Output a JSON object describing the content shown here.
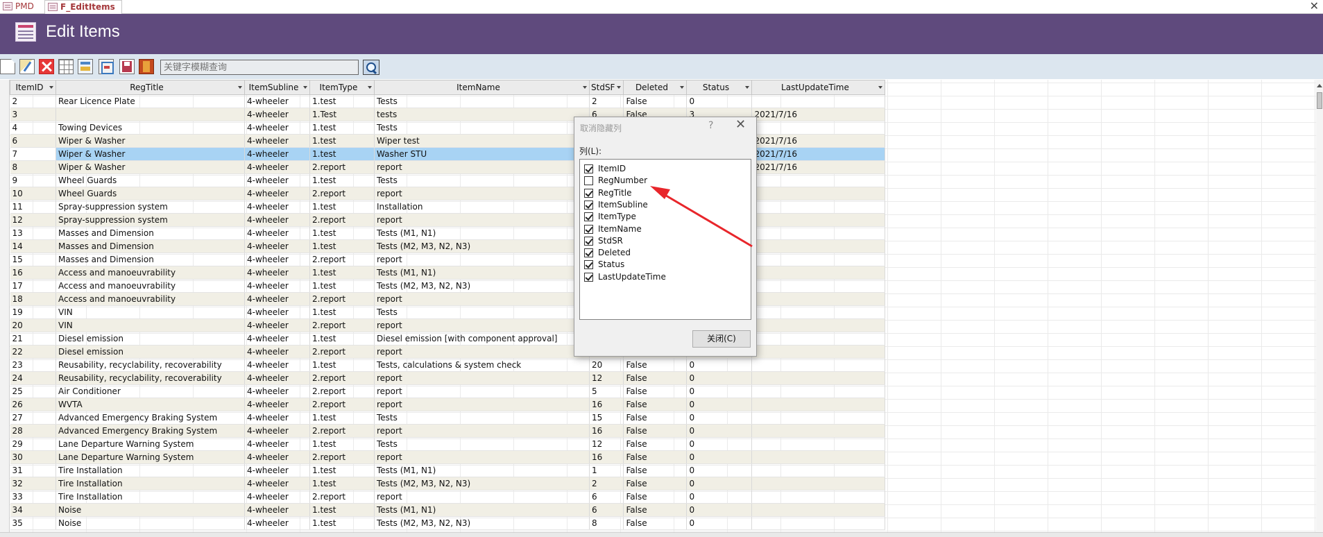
{
  "tabs": [
    {
      "label": "PMD"
    },
    {
      "label": "F_EditItems"
    }
  ],
  "window": {
    "close_glyph": "✕"
  },
  "header": {
    "title": "Edit Items"
  },
  "toolbar": {
    "buttons": [
      "new-record",
      "edit-record",
      "delete-record",
      "datasheet-view",
      "form-view",
      "form-view-alt",
      "save",
      "exit"
    ],
    "search_placeholder": "关键字模糊查询"
  },
  "table": {
    "columns": [
      {
        "label": "ItemID"
      },
      {
        "label": "RegTitle"
      },
      {
        "label": "ItemSubline"
      },
      {
        "label": "ItemType"
      },
      {
        "label": "ItemName"
      },
      {
        "label": "StdSF"
      },
      {
        "label": "Deleted"
      },
      {
        "label": "Status"
      },
      {
        "label": "LastUpdateTime"
      }
    ],
    "selected_row": 4,
    "rows": [
      [
        "2",
        "Rear Licence Plate",
        "4-wheeler",
        "1.test",
        "Tests",
        "2",
        "False",
        "0",
        ""
      ],
      [
        "3",
        "",
        "4-wheeler",
        "1.Test",
        "tests",
        "6",
        "False",
        "3",
        "2021/7/16"
      ],
      [
        "4",
        "Towing Devices",
        "4-wheeler",
        "1.test",
        "Tests",
        "",
        "",
        "",
        ""
      ],
      [
        "6",
        "Wiper & Washer",
        "4-wheeler",
        "1.test",
        "Wiper test",
        "",
        "",
        "",
        "2021/7/16"
      ],
      [
        "7",
        "Wiper & Washer",
        "4-wheeler",
        "1.test",
        "Washer STU",
        "",
        "",
        "",
        "2021/7/16"
      ],
      [
        "8",
        "Wiper & Washer",
        "4-wheeler",
        "2.report",
        "report",
        "",
        "",
        "",
        "2021/7/16"
      ],
      [
        "9",
        "Wheel Guards",
        "4-wheeler",
        "1.test",
        "Tests",
        "",
        "",
        "",
        ""
      ],
      [
        "10",
        "Wheel Guards",
        "4-wheeler",
        "2.report",
        "report",
        "",
        "",
        "",
        ""
      ],
      [
        "11",
        "Spray-suppression system",
        "4-wheeler",
        "1.test",
        "Installation",
        "",
        "",
        "",
        ""
      ],
      [
        "12",
        "Spray-suppression system",
        "4-wheeler",
        "2.report",
        "report",
        "",
        "",
        "",
        ""
      ],
      [
        "13",
        "Masses and Dimension",
        "4-wheeler",
        "1.test",
        "Tests (M1, N1)",
        "",
        "",
        "",
        ""
      ],
      [
        "14",
        "Masses and Dimension",
        "4-wheeler",
        "1.test",
        "Tests (M2, M3, N2, N3)",
        "",
        "",
        "",
        ""
      ],
      [
        "15",
        "Masses and Dimension",
        "4-wheeler",
        "2.report",
        "report",
        "",
        "",
        "",
        ""
      ],
      [
        "16",
        "Access and manoeuvrability",
        "4-wheeler",
        "1.test",
        "Tests (M1, N1)",
        "",
        "",
        "",
        ""
      ],
      [
        "17",
        "Access and manoeuvrability",
        "4-wheeler",
        "1.test",
        "Tests (M2, M3, N2, N3)",
        "",
        "",
        "",
        ""
      ],
      [
        "18",
        "Access and manoeuvrability",
        "4-wheeler",
        "2.report",
        "report",
        "",
        "",
        "",
        ""
      ],
      [
        "19",
        "VIN",
        "4-wheeler",
        "1.test",
        "Tests",
        "",
        "",
        "",
        ""
      ],
      [
        "20",
        "VIN",
        "4-wheeler",
        "2.report",
        "report",
        "",
        "",
        "",
        ""
      ],
      [
        "21",
        "Diesel emission",
        "4-wheeler",
        "1.test",
        "Diesel emission [with component approval]",
        "",
        "",
        "",
        ""
      ],
      [
        "22",
        "Diesel emission",
        "4-wheeler",
        "2.report",
        "report",
        "",
        "",
        "",
        ""
      ],
      [
        "23",
        "Reusability, recyclability, recoverability",
        "4-wheeler",
        "1.test",
        "Tests, calculations & system check",
        "20",
        "False",
        "0",
        ""
      ],
      [
        "24",
        "Reusability, recyclability, recoverability",
        "4-wheeler",
        "2.report",
        "report",
        "12",
        "False",
        "0",
        ""
      ],
      [
        "25",
        "Air Conditioner",
        "4-wheeler",
        "2.report",
        "report",
        "5",
        "False",
        "0",
        ""
      ],
      [
        "26",
        "WVTA",
        "4-wheeler",
        "2.report",
        "report",
        "16",
        "False",
        "0",
        ""
      ],
      [
        "27",
        "Advanced Emergency Braking System",
        "4-wheeler",
        "1.test",
        "Tests",
        "15",
        "False",
        "0",
        ""
      ],
      [
        "28",
        "Advanced Emergency Braking System",
        "4-wheeler",
        "2.report",
        "report",
        "16",
        "False",
        "0",
        ""
      ],
      [
        "29",
        "Lane Departure Warning System",
        "4-wheeler",
        "1.test",
        "Tests",
        "12",
        "False",
        "0",
        ""
      ],
      [
        "30",
        "Lane Departure Warning System",
        "4-wheeler",
        "2.report",
        "report",
        "16",
        "False",
        "0",
        ""
      ],
      [
        "31",
        "Tire Installation",
        "4-wheeler",
        "1.test",
        "Tests (M1, N1)",
        "1",
        "False",
        "0",
        ""
      ],
      [
        "32",
        "Tire Installation",
        "4-wheeler",
        "1.test",
        "Tests (M2, M3, N2, N3)",
        "2",
        "False",
        "0",
        ""
      ],
      [
        "33",
        "Tire Installation",
        "4-wheeler",
        "2.report",
        "report",
        "6",
        "False",
        "0",
        ""
      ],
      [
        "34",
        "Noise",
        "4-wheeler",
        "1.test",
        "Tests (M1, N1)",
        "6",
        "False",
        "0",
        ""
      ],
      [
        "35",
        "Noise",
        "4-wheeler",
        "1.test",
        "Tests (M2, M3, N2, N3)",
        "8",
        "False",
        "0",
        ""
      ]
    ]
  },
  "dialog": {
    "title": "取消隐藏列",
    "help": "?",
    "close": "✕",
    "list_label": "列(L):",
    "columns": [
      {
        "label": "ItemID",
        "checked": true
      },
      {
        "label": "RegNumber",
        "checked": false
      },
      {
        "label": "RegTitle",
        "checked": true
      },
      {
        "label": "ItemSubline",
        "checked": true
      },
      {
        "label": "ItemType",
        "checked": true
      },
      {
        "label": "ItemName",
        "checked": true
      },
      {
        "label": "StdSR",
        "checked": true
      },
      {
        "label": "Deleted",
        "checked": true
      },
      {
        "label": "Status",
        "checked": true
      },
      {
        "label": "LastUpdateTime",
        "checked": true
      }
    ],
    "close_button": "关闭(C)"
  },
  "annotation": {
    "color": "#e8262b"
  }
}
